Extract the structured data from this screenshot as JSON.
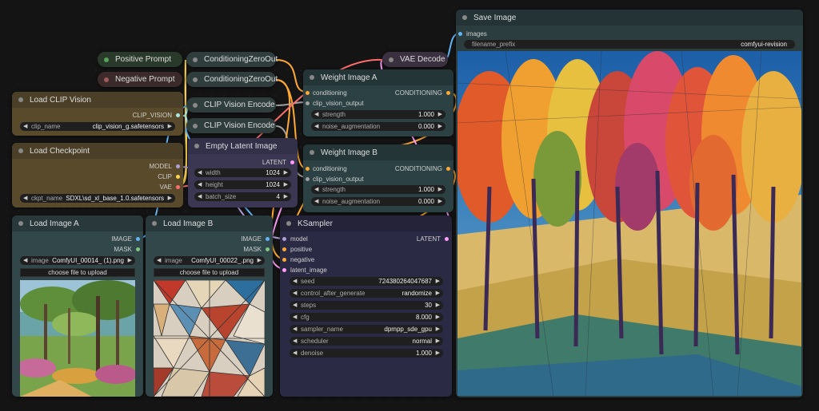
{
  "nodes": {
    "positive_prompt": {
      "title": "Positive Prompt"
    },
    "negative_prompt": {
      "title": "Negative Prompt"
    },
    "cond_zero_1": {
      "title": "ConditioningZeroOut"
    },
    "cond_zero_2": {
      "title": "ConditioningZeroOut"
    },
    "vae_decode": {
      "title": "VAE Decode"
    },
    "clip_vision_encode_1": {
      "title": "CLIP Vision Encode"
    },
    "clip_vision_encode_2": {
      "title": "CLIP Vision Encode"
    },
    "load_clip_vision": {
      "title": "Load CLIP Vision",
      "output": "CLIP_VISION",
      "widget": {
        "label": "clip_name",
        "value": "clip_vision_g.safetensors"
      }
    },
    "load_checkpoint": {
      "title": "Load Checkpoint",
      "outputs": [
        "MODEL",
        "CLIP",
        "VAE"
      ],
      "widget": {
        "label": "ckpt_name",
        "value": "SDXL\\sd_xl_base_1.0.safetensors"
      }
    },
    "empty_latent": {
      "title": "Empty Latent Image",
      "output": "LATENT",
      "widgets": [
        {
          "label": "width",
          "value": "1024"
        },
        {
          "label": "height",
          "value": "1024"
        },
        {
          "label": "batch_size",
          "value": "4"
        }
      ]
    },
    "weight_a": {
      "title": "Weight Image A",
      "inputs": [
        "conditioning",
        "clip_vision_output"
      ],
      "output": "CONDITIONING",
      "widgets": [
        {
          "label": "strength",
          "value": "1.000"
        },
        {
          "label": "noise_augmentation",
          "value": "0.000"
        }
      ]
    },
    "weight_b": {
      "title": "Weight Image B",
      "inputs": [
        "conditioning",
        "clip_vision_output"
      ],
      "output": "CONDITIONING",
      "widgets": [
        {
          "label": "strength",
          "value": "1.000"
        },
        {
          "label": "noise_augmentation",
          "value": "0.000"
        }
      ]
    },
    "load_image_a": {
      "title": "Load Image A",
      "outputs": [
        "IMAGE",
        "MASK"
      ],
      "widget": {
        "label": "image",
        "value": "ComfyUI_00014_ (1).png"
      },
      "button": "choose file to upload"
    },
    "load_image_b": {
      "title": "Load Image B",
      "outputs": [
        "IMAGE",
        "MASK"
      ],
      "widget": {
        "label": "image",
        "value": "ComfyUI_00022_.png"
      },
      "button": "choose file to upload"
    },
    "ksampler": {
      "title": "KSampler",
      "inputs": [
        "model",
        "positive",
        "negative",
        "latent_image"
      ],
      "output": "LATENT",
      "widgets": [
        {
          "label": "seed",
          "value": "724380264047687"
        },
        {
          "label": "control_after_generate",
          "value": "randomize"
        },
        {
          "label": "steps",
          "value": "30"
        },
        {
          "label": "cfg",
          "value": "8.000"
        },
        {
          "label": "sampler_name",
          "value": "dpmpp_sde_gpu"
        },
        {
          "label": "scheduler",
          "value": "normal"
        },
        {
          "label": "denoise",
          "value": "1.000"
        }
      ]
    },
    "save_image": {
      "title": "Save Image",
      "input": "images",
      "widget": {
        "label": "filename_prefix",
        "value": "comfyui-revision"
      }
    }
  },
  "colors": {
    "model": "#b39ddb",
    "clip": "#ffd54f",
    "vae": "#ff6e6e",
    "conditioning": "#ffa931",
    "latent": "#ff9cf9",
    "image": "#64b5f6",
    "mask": "#81c784",
    "clip_vision": "#a8e6e0",
    "clip_vision_output": "#a0a0a0"
  }
}
